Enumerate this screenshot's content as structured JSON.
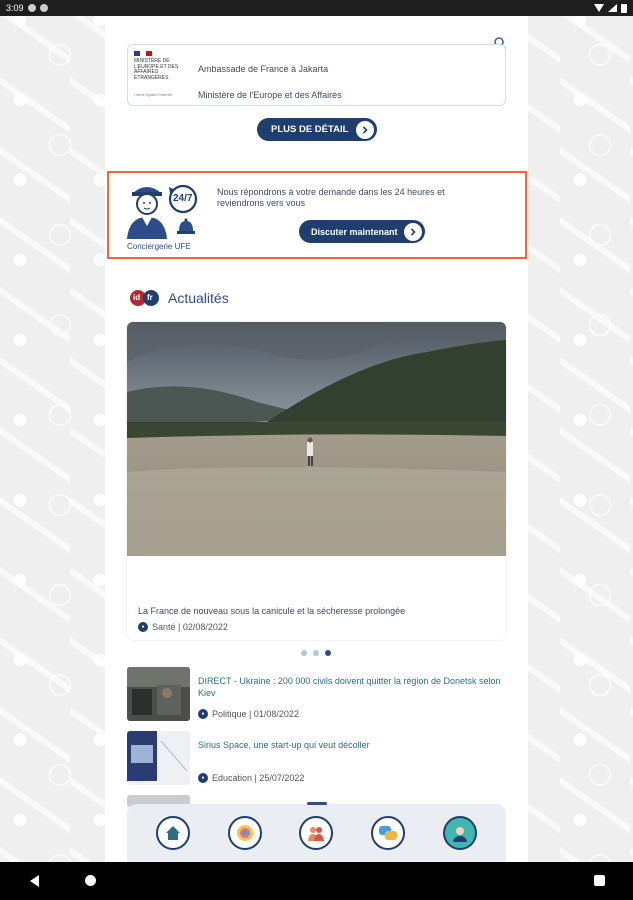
{
  "status_bar": {
    "time": "3:09"
  },
  "embassy": {
    "logo_text": "MINISTÈRE DE L'EUROPE ET DES AFFAIRES ÉTRANGÈRES",
    "logo_sub": "Liberté Égalité Fraternité",
    "name": "Ambassade de France à Jakarta",
    "ministry": "Ministère de l'Europe et des Affaires",
    "detail_button": "PLUS DE DÉTAIL"
  },
  "concierge": {
    "badge": "24/7",
    "label": "Conciergerie UFE",
    "text": "Nous répondrons à votre demande dans les 24 heures et reviendrons vers vous",
    "chat_button": "Discuter maintenant"
  },
  "news": {
    "logo_left": "id",
    "logo_right": "fr",
    "title": "Actualités",
    "featured": {
      "title": "La France de nouveau sous la canicule et la sécheresse prolongée",
      "category_meta": "Santé | 02/08/2022"
    },
    "carousel": {
      "count": 3,
      "active_index": 2
    },
    "items": [
      {
        "title": "DIRECT - Ukraine : 200 000 civils doivent quitter la région de Donetsk selon Kiev",
        "meta": "Politique | 01/08/2022"
      },
      {
        "title": "Sirius Space, une start-up qui veut décoller",
        "meta": "Education | 25/07/2022"
      }
    ]
  },
  "bottom_nav": {
    "items": [
      "home-icon",
      "globe-icon",
      "community-icon",
      "chat-icon",
      "profile-icon"
    ],
    "active_index": 2
  },
  "colors": {
    "brand": "#1f3e6d",
    "accent": "#ee6a34",
    "link": "#2c6f84"
  }
}
